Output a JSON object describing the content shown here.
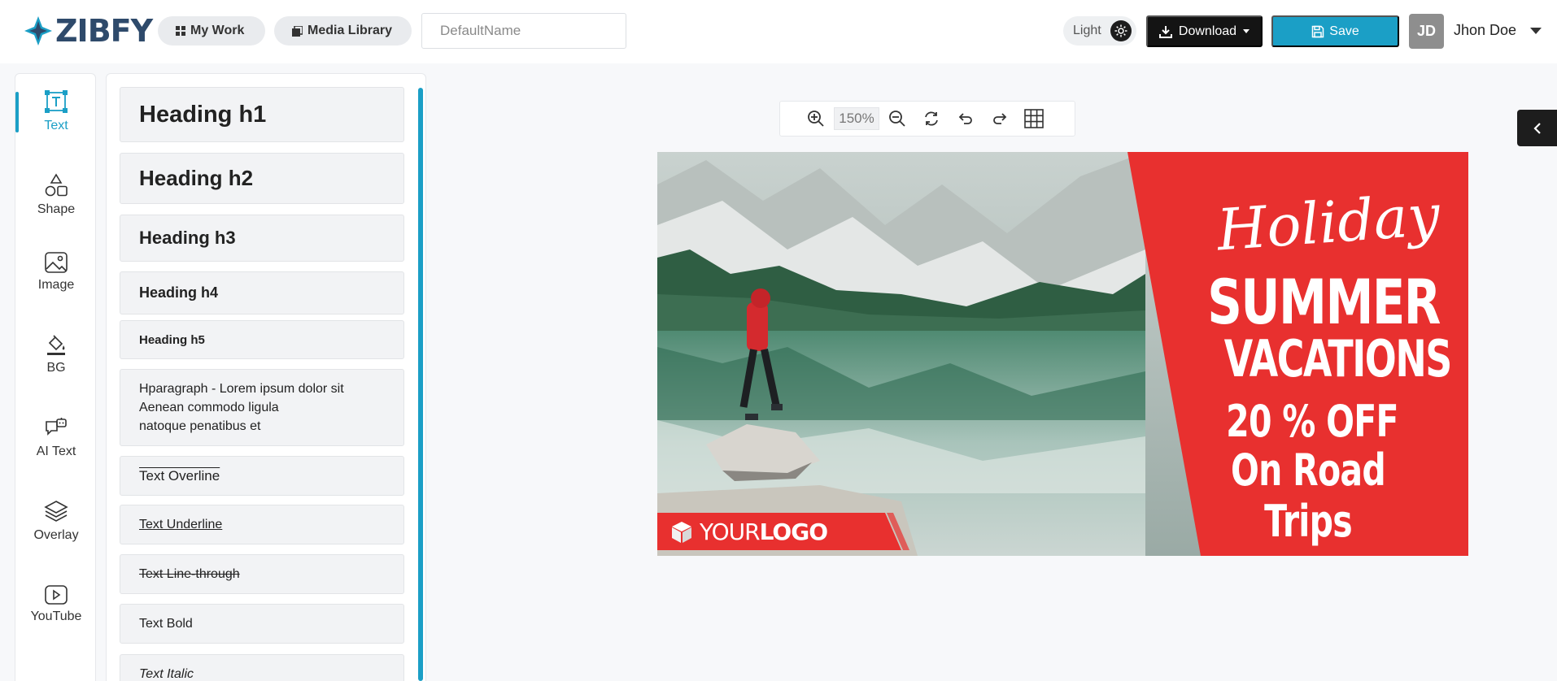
{
  "app": {
    "brand": "ZIBFY"
  },
  "header": {
    "my_work": "My Work",
    "media_library": "Media Library",
    "name_placeholder": "DefaultName",
    "theme_label": "Light",
    "download_label": "Download",
    "save_label": "Save",
    "user_initials": "JD",
    "user_name": "Jhon Doe"
  },
  "rail": {
    "items": [
      {
        "label": "Text",
        "icon": "text-frame-icon",
        "active": true
      },
      {
        "label": "Shape",
        "icon": "shapes-icon"
      },
      {
        "label": "Image",
        "icon": "image-icon"
      },
      {
        "label": "BG",
        "icon": "paint-bucket-icon"
      },
      {
        "label": "AI Text",
        "icon": "ai-chat-icon"
      },
      {
        "label": "Overlay",
        "icon": "layers-icon"
      },
      {
        "label": "YouTube",
        "icon": "youtube-icon"
      }
    ]
  },
  "text_panel": {
    "items": [
      {
        "label": "Heading h1"
      },
      {
        "label": "Heading h2"
      },
      {
        "label": "Heading h3"
      },
      {
        "label": "Heading h4"
      },
      {
        "label": "Heading h5"
      },
      {
        "line1": "Hparagraph - Lorem ipsum dolor sit",
        "line2": "Aenean commodo ligula",
        "line3": "natoque penatibus et"
      },
      {
        "label": "Text Overline"
      },
      {
        "label": "Text Underline"
      },
      {
        "label": "Text Line-through"
      },
      {
        "label": "Text Bold"
      },
      {
        "label": "Text Italic"
      }
    ]
  },
  "canvas": {
    "zoom": "150%",
    "banner": {
      "holiday": "Holiday",
      "summer": "SUMMER",
      "vacations": "VACATIONS",
      "offer": "20 % OFF",
      "road_trips": "On Road Trips",
      "logo_light": "YOUR",
      "logo_bold": "LOGO"
    }
  },
  "colors": {
    "accent": "#1b9fc6",
    "banner_red": "#e8302f",
    "dark_button": "#141414"
  }
}
